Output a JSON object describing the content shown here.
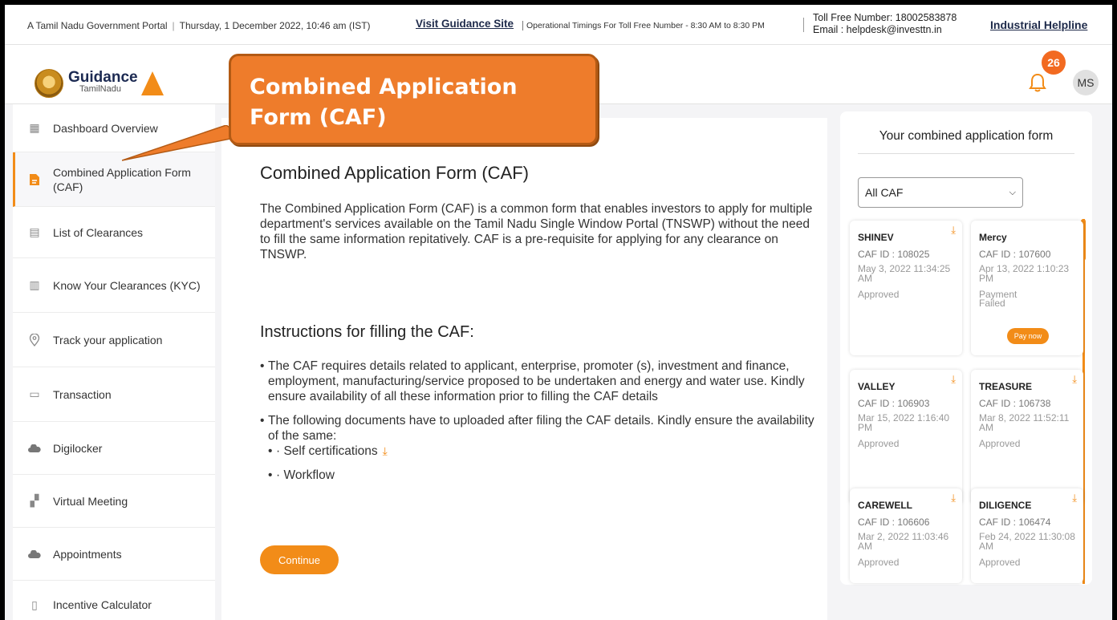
{
  "topbar": {
    "portal": "A Tamil Nadu Government Portal",
    "datetime": "Thursday, 1 December 2022, 10:46 am (IST)",
    "guidance_link": "Visit Guidance Site",
    "op_timings": "Operational Timings For Toll Free Number - 8:30 AM to 8:30 PM",
    "toll_free": "Toll Free Number: 18002583878",
    "email": "Email : helpdesk@investtn.in",
    "helpline": "Industrial Helpline"
  },
  "header": {
    "logo_text": "Guidance",
    "logo_sub": "TamilNadu",
    "notifications": "26",
    "avatar": "MS"
  },
  "callout": {
    "line1": "Combined Application",
    "line2": "Form (CAF)"
  },
  "sidebar": {
    "items": [
      {
        "label": "Dashboard Overview",
        "icon": "grid-icon"
      },
      {
        "label": "Combined Application Form (CAF)",
        "icon": "document-icon"
      },
      {
        "label": "List of Clearances",
        "icon": "list-icon"
      },
      {
        "label": "Know Your Clearances (KYC)",
        "icon": "book-icon"
      },
      {
        "label": "Track your application",
        "icon": "location-icon"
      },
      {
        "label": "Transaction",
        "icon": "transaction-icon"
      },
      {
        "label": "Digilocker",
        "icon": "cloud-icon"
      },
      {
        "label": "Virtual Meeting",
        "icon": "meeting-icon"
      },
      {
        "label": "Appointments",
        "icon": "cloud-icon"
      },
      {
        "label": "Incentive Calculator",
        "icon": "calculator-icon"
      }
    ]
  },
  "main": {
    "title": "Combined Application Form (CAF)",
    "intro": "The Combined Application Form (CAF) is a common form that enables investors to apply for multiple department's services available on the Tamil Nadu Single Window Portal (TNSWP) without the need to fill the same information repitatively. CAF is a pre-requisite for applying for any clearance on TNSWP.",
    "instructions_title": "Instructions for filling the CAF:",
    "instruction1": "The CAF requires details related to applicant, enterprise, promoter (s), investment and finance, employment, manufacturing/service proposed to be undertaken and energy and water use. Kindly ensure availability of all these information prior to filling the CAF details",
    "instruction2": "The following documents have to uploaded after filing the CAF details. Kindly ensure the availability of the same:",
    "doc1": "· Self certifications",
    "doc2": "· Workflow",
    "continue_label": "Continue"
  },
  "panel": {
    "title": "Your combined application form",
    "filter": "All CAF",
    "cards": [
      {
        "name": "SHINEV",
        "caf_id": "CAF ID : 108025",
        "date": "May 3, 2022 11:34:25 AM",
        "status": "Approved"
      },
      {
        "name": "Mercy",
        "caf_id": "CAF ID : 107600",
        "date": "Apr 13, 2022 1:10:23 PM",
        "status": "Payment Failed",
        "action": "Pay now"
      },
      {
        "name": "VALLEY",
        "caf_id": "CAF ID : 106903",
        "date": "Mar 15, 2022 1:16:40 PM",
        "status": "Approved"
      },
      {
        "name": "TREASURE",
        "caf_id": "CAF ID : 106738",
        "date": "Mar 8, 2022 11:52:11 AM",
        "status": "Approved"
      },
      {
        "name": "CAREWELL",
        "caf_id": "CAF ID : 106606",
        "date": "Mar 2, 2022 11:03:46 AM",
        "status": "Approved"
      },
      {
        "name": "DILIGENCE",
        "caf_id": "CAF ID : 106474",
        "date": "Feb 24, 2022 11:30:08 AM",
        "status": "Approved"
      }
    ]
  },
  "colors": {
    "accent": "#f28c18",
    "callout": "#ee7c2b",
    "badge": "#f26a21"
  }
}
